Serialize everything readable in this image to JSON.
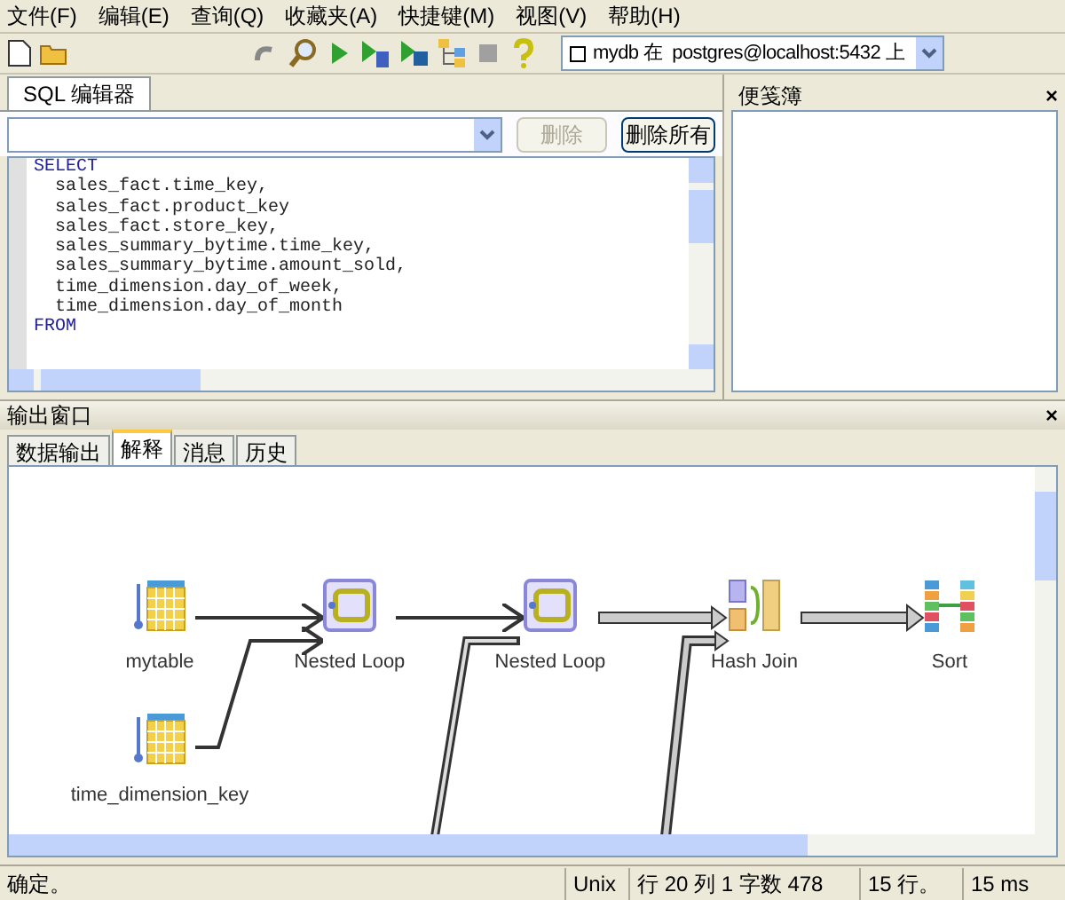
{
  "menu": [
    "文件(F)",
    "编辑(E)",
    "查询(Q)",
    "收藏夹(A)",
    "快捷键(M)",
    "视图(V)",
    "帮助(H)"
  ],
  "toolbar": {
    "connection": "mydb 在  postgres@localhost:5432 上"
  },
  "sql_tab": {
    "label": "SQL 编辑器",
    "selected": true
  },
  "query_bar": {
    "delete": "删除",
    "delete_disabled": true,
    "delete_all": "删除所有"
  },
  "sql_lines": [
    {
      "kind": "keyword",
      "text": "SELECT"
    },
    {
      "kind": "code",
      "text": "sales_fact.time_key,"
    },
    {
      "kind": "code",
      "text": "sales_fact.product_key"
    },
    {
      "kind": "code",
      "text": "sales_fact.store_key,"
    },
    {
      "kind": "code",
      "text": "sales_summary_bytime.time_key,"
    },
    {
      "kind": "code",
      "text": "sales_summary_bytime.amount_sold,"
    },
    {
      "kind": "code",
      "text": "time_dimension.day_of_week,"
    },
    {
      "kind": "code",
      "text": "time_dimension.day_of_month"
    },
    {
      "kind": "keyword",
      "text": "FROM"
    }
  ],
  "notepad": {
    "title": "便笺簿",
    "close": "×"
  },
  "output": {
    "title": "输出窗口",
    "close": "×"
  },
  "output_tabs": [
    {
      "label": "数据输出",
      "selected": false
    },
    {
      "label": "解释",
      "selected": true
    },
    {
      "label": "消息",
      "selected": false
    },
    {
      "label": "历史",
      "selected": false
    }
  ],
  "plan_nodes": [
    {
      "kind": "table",
      "label": "mytable"
    },
    {
      "kind": "table",
      "label": "time_dimension_key"
    },
    {
      "kind": "loop",
      "label": "Nested Loop"
    },
    {
      "kind": "loop",
      "label": "Nested Loop"
    },
    {
      "kind": "hash",
      "label": "Hash Join"
    },
    {
      "kind": "sort",
      "label": "Sort"
    }
  ],
  "status_bar": [
    "确定。",
    "Unix",
    "行 20 列 1 字数 478",
    "15 行。",
    "15 ms"
  ]
}
